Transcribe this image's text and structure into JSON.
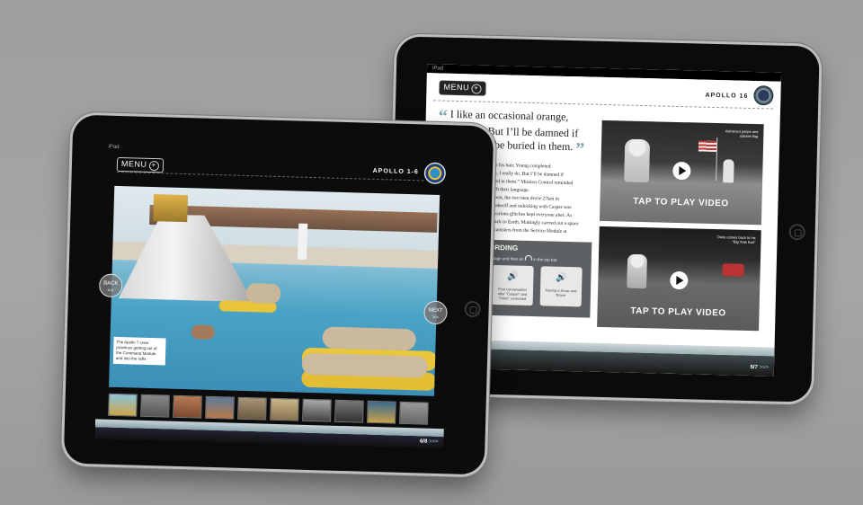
{
  "back_tablet": {
    "status": "iPad",
    "menu_label": "MENU",
    "mission": "APOLLO 16",
    "quote_open": "“",
    "quote_close": "”",
    "quote_lines": [
      "I like an occasional orange,",
      "I really do. But I’ll be damned if",
      "I’m going to be buried in them."
    ],
    "body_lines": [
      "nk in his hair. Young completed:",
      "ange, I really do. But I’ll be damned if",
      "buried in them.” Mission Control reminded",
      "watch their language.",
      "e Moon, the two men drove 27km in",
      "ing takeoff and redocking with Casper was",
      "but various glitches kept everyone alert. As",
      "ay back to Earth, Mattingly carried out a space",
      "ilm canisters from the Service Module at"
    ],
    "recording_title": "ORDING",
    "recording_hint": "n page and then on",
    "recording_hint_end": "in the top bar.",
    "audio_items": [
      {
        "icon": "speaker-icon",
        "caption": "First conversation after “Casper” and “Orion” undocked"
      },
      {
        "icon": "speaker-icon",
        "caption": "Having a Snow and Rover"
      }
    ],
    "videos": [
      {
        "label": "TAP TO PLAY VIDEO",
        "caption": "Astronaut jumps and salutes flag"
      },
      {
        "label": "TAP TO PLAY VIDEO",
        "caption": "Duke comes back to his “Big Trak Kart”"
      }
    ],
    "page_number": "5/7",
    "page_arrows": ">>>"
  },
  "front_tablet": {
    "status": "iPad",
    "menu_label": "MENU",
    "mission": "APOLLO 1-6",
    "back_label": "BACK",
    "back_arrows": "<<",
    "next_label": "NEXT",
    "next_arrows": ">>",
    "photo_caption": "The Apollo 7 crew practices getting out of the Command Module and into the rafts",
    "thumbnail_count": 10,
    "page_number": "6/8",
    "page_arrows": ">>>"
  }
}
